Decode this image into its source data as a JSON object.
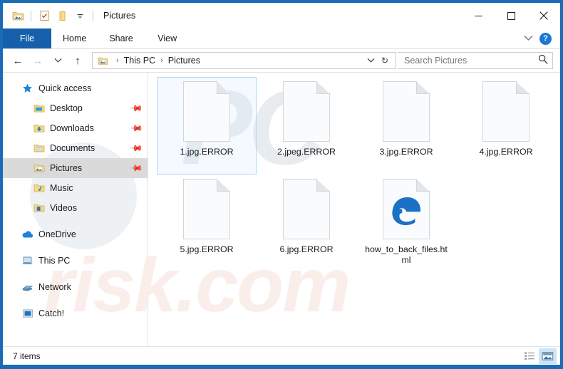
{
  "window": {
    "title": "Pictures",
    "border_color": "#1a6bb5",
    "quick_access": [
      {
        "name": "explorer-icon",
        "tip": "File Explorer"
      },
      {
        "name": "properties-icon",
        "tip": "Properties"
      },
      {
        "name": "new-folder-icon",
        "tip": "New folder"
      },
      {
        "name": "chevron-down-icon",
        "tip": "Customize Quick Access Toolbar"
      }
    ],
    "controls": {
      "minimize": "─",
      "maximize": "☐",
      "close": "✕"
    }
  },
  "ribbon": {
    "tabs": [
      {
        "label": "File",
        "active": true
      },
      {
        "label": "Home",
        "active": false
      },
      {
        "label": "Share",
        "active": false
      },
      {
        "label": "View",
        "active": false
      }
    ],
    "expand_icon": "∨",
    "help_label": "?",
    "file_tab_color": "#1660ab"
  },
  "address": {
    "back_icon": "←",
    "forward_icon": "→",
    "recent_icon": "∨",
    "up_icon": "↑",
    "breadcrumb": [
      "This PC",
      "Pictures"
    ],
    "separator": "›",
    "dropdown_icon": "∨",
    "refresh_icon": "↻",
    "search_placeholder": "Search Pictures",
    "search_value": "",
    "search_icon": "search-icon"
  },
  "sidebar": {
    "items": [
      {
        "label": "Quick access",
        "icon": "star-icon",
        "level": "root",
        "pinned": false,
        "selected": false
      },
      {
        "label": "Desktop",
        "icon": "folder-desktop-icon",
        "level": "indent",
        "pinned": true,
        "selected": false
      },
      {
        "label": "Downloads",
        "icon": "folder-downloads-icon",
        "level": "indent",
        "pinned": true,
        "selected": false
      },
      {
        "label": "Documents",
        "icon": "folder-documents-icon",
        "level": "indent",
        "pinned": true,
        "selected": false
      },
      {
        "label": "Pictures",
        "icon": "folder-pictures-icon",
        "level": "indent",
        "pinned": true,
        "selected": true
      },
      {
        "label": "Music",
        "icon": "folder-music-icon",
        "level": "indent",
        "pinned": false,
        "selected": false
      },
      {
        "label": "Videos",
        "icon": "folder-videos-icon",
        "level": "indent",
        "pinned": false,
        "selected": false
      },
      {
        "label": "OneDrive",
        "icon": "cloud-icon",
        "level": "root",
        "pinned": false,
        "selected": false,
        "gap_before": true
      },
      {
        "label": "This PC",
        "icon": "computer-icon",
        "level": "root",
        "pinned": false,
        "selected": false,
        "gap_before": true
      },
      {
        "label": "Network",
        "icon": "network-icon",
        "level": "root",
        "pinned": false,
        "selected": false,
        "gap_before": true
      },
      {
        "label": "Catch!",
        "icon": "drive-icon",
        "level": "root",
        "pinned": false,
        "selected": false,
        "gap_before": true
      }
    ]
  },
  "files": [
    {
      "name": "1.jpg.ERROR",
      "icon": "blank-page-icon",
      "selected": true
    },
    {
      "name": "2.jpeg.ERROR",
      "icon": "blank-page-icon",
      "selected": false
    },
    {
      "name": "3.jpg.ERROR",
      "icon": "blank-page-icon",
      "selected": false
    },
    {
      "name": "4.jpg.ERROR",
      "icon": "blank-page-icon",
      "selected": false
    },
    {
      "name": "5.jpg.ERROR",
      "icon": "blank-page-icon",
      "selected": false
    },
    {
      "name": "6.jpg.ERROR",
      "icon": "blank-page-icon",
      "selected": false
    },
    {
      "name": "how_to_back_files.html",
      "icon": "edge-html-icon",
      "selected": false
    }
  ],
  "status": {
    "item_count": "7 items",
    "views": [
      {
        "name": "details-view-button",
        "active": false
      },
      {
        "name": "large-icons-view-button",
        "active": true
      }
    ]
  },
  "watermarks": {
    "top": "PC",
    "bottom": "risk.com"
  }
}
